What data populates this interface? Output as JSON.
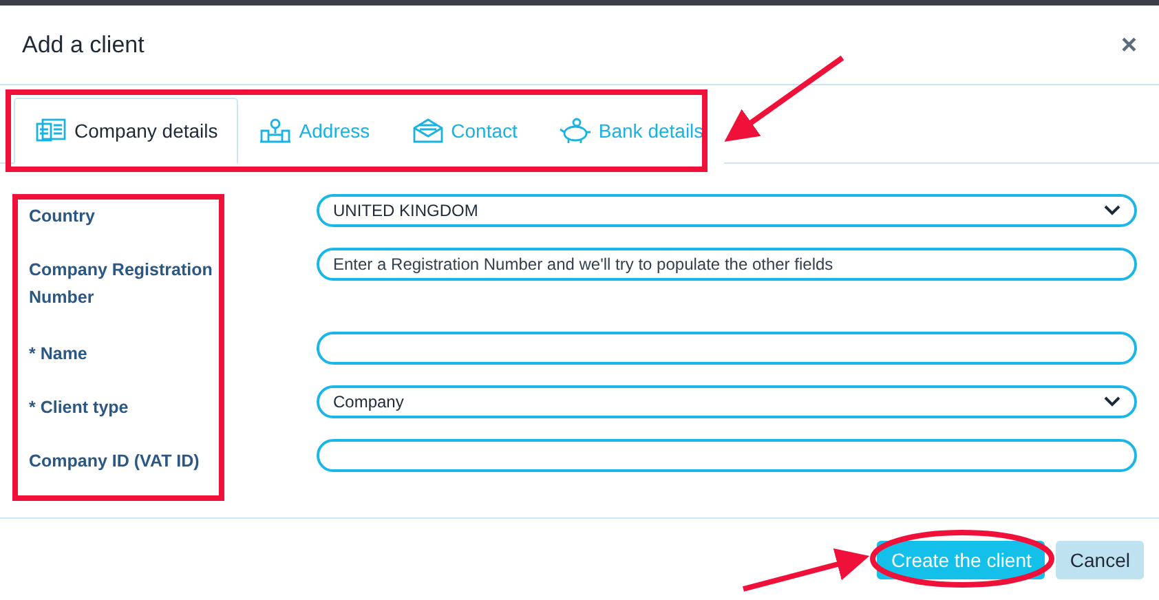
{
  "dialog": {
    "title": "Add a client",
    "close": "×"
  },
  "tabs": [
    {
      "label": "Company details",
      "kind": "card",
      "selected": true
    },
    {
      "label": "Address",
      "kind": "building",
      "selected": false
    },
    {
      "label": "Contact",
      "kind": "envelope",
      "selected": false
    },
    {
      "label": "Bank details",
      "kind": "piggy",
      "selected": false
    }
  ],
  "fields": [
    {
      "label": "Country",
      "kind": "select",
      "value": "UNITED KINGDOM"
    },
    {
      "label": "Company Registration Number",
      "kind": "text",
      "placeholder": "Enter a Registration Number and we'll try to populate the other fields"
    },
    {
      "label": "* Name",
      "kind": "text"
    },
    {
      "label": "* Client type",
      "kind": "select",
      "value": "Company"
    },
    {
      "label": "Company ID (VAT ID)",
      "kind": "text"
    }
  ],
  "buttons": [
    {
      "label": "Create the client",
      "kind": "primary"
    },
    {
      "label": "Cancel",
      "kind": "secondary"
    }
  ]
}
